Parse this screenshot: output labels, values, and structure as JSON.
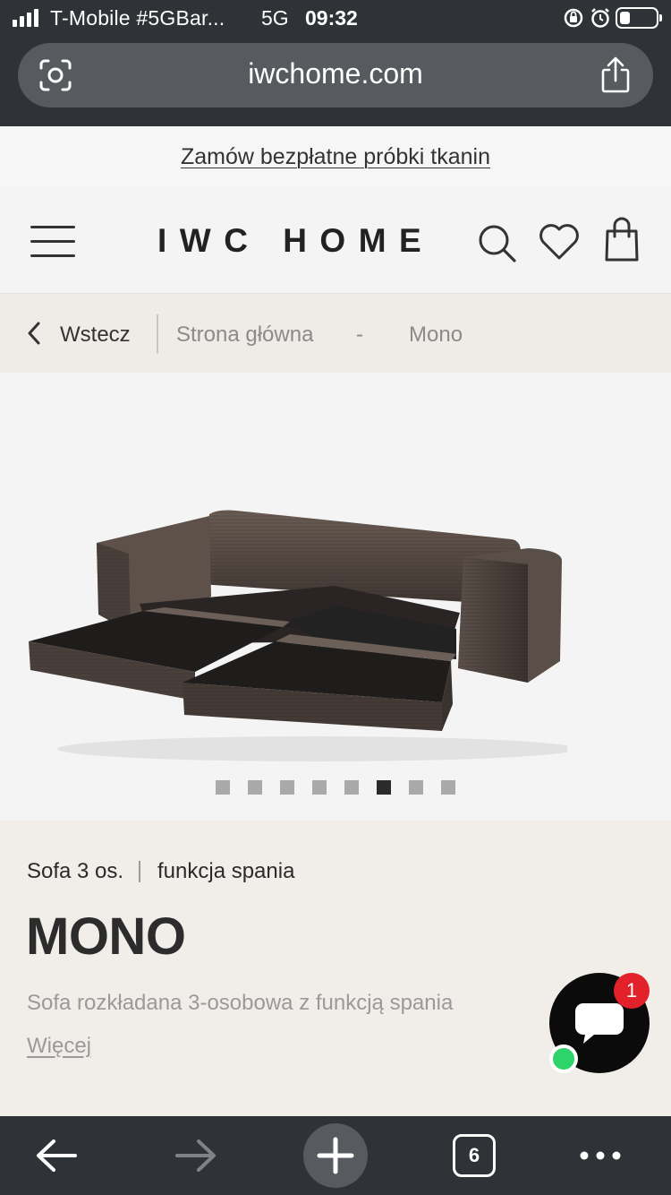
{
  "status_bar": {
    "carrier": "T-Mobile #5GBar...",
    "network": "5G",
    "time": "09:32"
  },
  "browser": {
    "url": "iwchome.com",
    "tab_count": "6"
  },
  "promo": {
    "text": "Zamów bezpłatne próbki tkanin"
  },
  "header": {
    "brand": "IWC HOME"
  },
  "breadcrumb": {
    "back": "Wstecz",
    "home": "Strona główna",
    "separator": "-",
    "current": "Mono"
  },
  "gallery": {
    "total_images": 8,
    "active_index": 5
  },
  "product": {
    "category_1": "Sofa 3 os.",
    "category_2": "funkcja spania",
    "title": "MONO",
    "subtitle": "Sofa rozkładana 3-osobowa z funkcją spania",
    "more": "Więcej"
  },
  "chat": {
    "badge": "1"
  },
  "colors": {
    "chrome": "#2f3236",
    "urlbar": "#575b60",
    "page_bg": "#f1eeea",
    "chat_badge": "#e3212b",
    "online": "#2ed36a"
  }
}
